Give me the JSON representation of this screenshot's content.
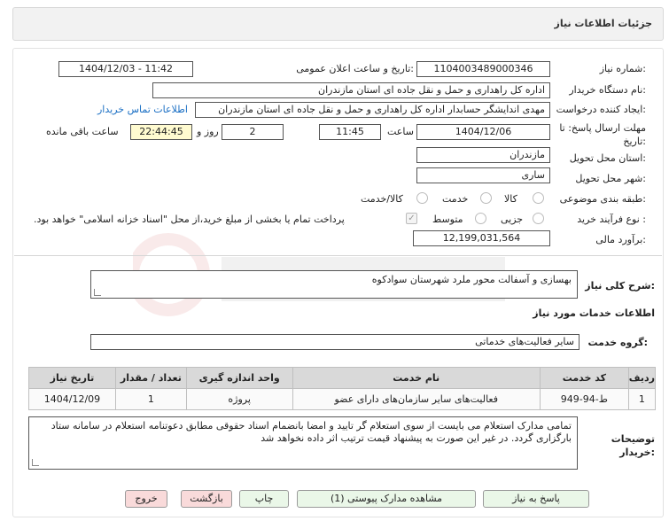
{
  "header": {
    "title": "جزئیات اطلاعات نیاز"
  },
  "fields": {
    "need_number_label": "شماره نیاز:",
    "need_number": "1104003489000346",
    "announce_label": "تاریخ و ساعت اعلان عمومی:",
    "announce_value": "1404/12/03 - 11:42",
    "buyer_org_label": "نام دستگاه خریدار:",
    "buyer_org": "اداره کل راهداری و حمل و نقل جاده ای استان مازندران",
    "requester_label": "ایجاد کننده درخواست:",
    "requester": "مهدی اندایشگر حسابدار اداره کل راهداری و حمل و نقل جاده ای استان مازندران",
    "contact_link": "اطلاعات تماس خریدار",
    "deadline_label": "مهلت ارسال پاسخ: تا تاریخ:",
    "deadline_date": "1404/12/06",
    "time_label": "ساعت",
    "deadline_time": "11:45",
    "days_value": "2",
    "days_label": "روز و",
    "remaining_time": "22:44:45",
    "remaining_label": "ساعت باقی مانده",
    "province_label": "استان محل تحویل:",
    "province": "مازندران",
    "city_label": "شهر محل تحویل:",
    "city": "ساری",
    "category_label": "طبقه بندی موضوعی:",
    "category_options": [
      "کالا",
      "خدمت",
      "کالا/خدمت"
    ],
    "process_label": "نوع فرآیند خرید :",
    "process_options": [
      "جزیی",
      "متوسط"
    ],
    "payment_note": "پرداخت تمام یا بخشی از مبلغ خرید،از محل \"اسناد خزانه اسلامی\" خواهد بود.",
    "estimate_label": "برآورد مالی:",
    "estimate": "12,199,031,564"
  },
  "summary": {
    "label": "شرح کلی نیاز:",
    "text": "بهسازی و آسفالت محور ملرد شهرستان سوادکوه"
  },
  "services": {
    "section_title": "اطلاعات خدمات مورد نیاز",
    "group_label": "گروه خدمت:",
    "group_value": "سایر فعالیت‌های خدماتی",
    "columns": [
      "ردیف",
      "کد خدمت",
      "نام خدمت",
      "واحد اندازه گیری",
      "تعداد / مقدار",
      "تاریخ نیاز"
    ],
    "rows": [
      [
        "1",
        "ط-94-949",
        "فعالیت‌های سایر سازمان‌های دارای عضو",
        "پروژه",
        "1",
        "1404/12/09"
      ]
    ]
  },
  "notes": {
    "label": "توضیحات خریدار:",
    "text": "تمامی مدارک استعلام می بایست از سوی استعلام گر تایید و امضا بانضمام اسناد حقوقی مطابق دعوتنامه استعلام در سامانه ستاد بارگزاری گردد. در غیر این صورت به پیشنهاد قیمت ترتیب اثر داده نخواهد شد"
  },
  "buttons": {
    "reply": "پاسخ به نیاز",
    "attachments": "مشاهده مدارک پیوستی (1)",
    "print": "چاپ",
    "back": "بازگشت",
    "exit": "خروج"
  },
  "colors": {
    "link": "#1a6fc4",
    "timer_bg": "#fffbd0",
    "button_green": "#eaf7e8",
    "button_red": "#f9dada"
  }
}
